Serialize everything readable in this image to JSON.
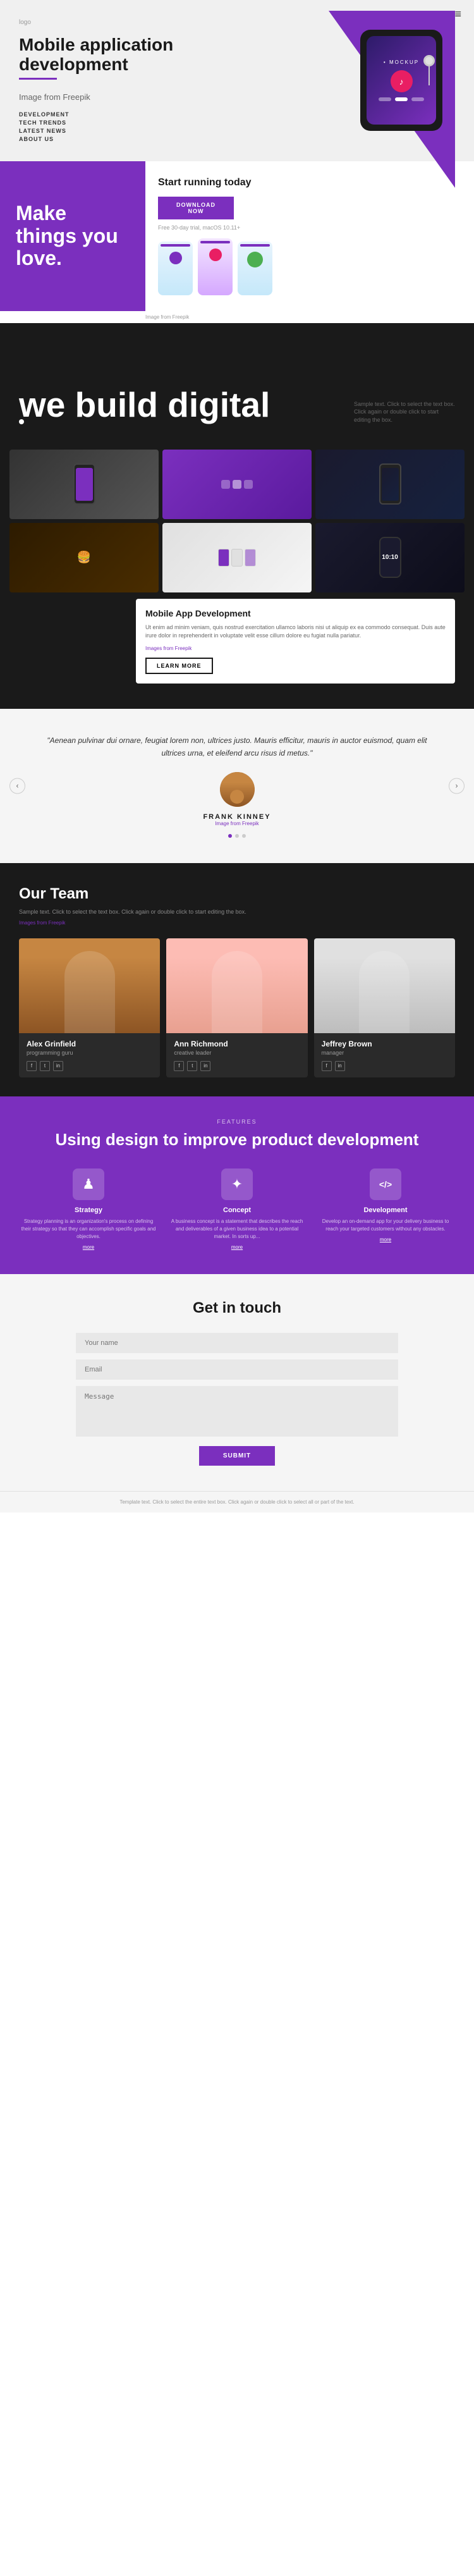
{
  "header": {
    "logo": "logo",
    "hamburger": "≡",
    "hero_title": "Mobile application development",
    "hero_subtitle": "Image from Freepik",
    "nav_items": [
      "DEVELOPMENT",
      "TECH TRENDS",
      "LATEST NEWS",
      "ABOUT US"
    ],
    "mockup_label": "• MOCKUP"
  },
  "section_make": {
    "title": "Make things you love.",
    "start_running_title": "Start running today",
    "download_btn": "DOWNLOAD NOW",
    "trial_text": "Free 30-day trial, macOS 10.11+",
    "image_from": "Image from Freepik"
  },
  "section_build": {
    "title": "we build digital",
    "sample_text": "Sample text. Click to select the text box. Click again or double click to start editing the box."
  },
  "section_portfolio": {
    "mobile_app_title": "Mobile App Development",
    "mobile_app_text": "Ut enim ad minim veniam, quis nostrud exercitation ullamco laboris nisi ut aliquip ex ea commodo consequat. Duis aute irure dolor in reprehenderit in voluptate velit esse cillum dolore eu fugiat nulla pariatur.",
    "images_from": "Images from Freepik",
    "learn_more": "LEARN MORE"
  },
  "section_testimonial": {
    "quote": "\"Aenean pulvinar dui ornare, feugiat lorem non, ultrices justo. Mauris efficitur, mauris in auctor euismod, quam elit ultrices urna, et eleifend arcu risus id metus.\"",
    "name": "FRANK KINNEY",
    "image_from": "Image from Freepik",
    "dots": [
      true,
      false,
      false
    ]
  },
  "section_team": {
    "title": "Our Team",
    "sample_text": "Sample text. Click to select the text box. Click again or double click to start editing the box.",
    "images_from": "Images from Freepik",
    "members": [
      {
        "name": "Alex Grinfield",
        "role": "programming guru"
      },
      {
        "name": "Ann Richmond",
        "role": "creative leader"
      },
      {
        "name": "Jeffrey Brown",
        "role": "manager"
      }
    ]
  },
  "section_features": {
    "label": "FEATURES",
    "title": "Using design to improve product development",
    "features": [
      {
        "name": "Strategy",
        "icon": "♟",
        "desc": "Strategy planning is an organization's process on defining their strategy so that they can accomplish specific goals and objectives.",
        "link": "more"
      },
      {
        "name": "Concept",
        "icon": "✦",
        "desc": "A business concept is a statement that describes the reach and deliverables of a given business idea to a potential market. In sorts up...",
        "link": "more"
      },
      {
        "name": "Development",
        "icon": "</>",
        "desc": "Develop an on-demand app for your delivery business to reach your targeted customers without any obstacles.",
        "link": "more"
      }
    ]
  },
  "section_contact": {
    "title": "Get in touch",
    "fields": {
      "name_placeholder": "Your name",
      "email_placeholder": "Email",
      "message_placeholder": "Message"
    },
    "submit_btn": "SUBMIT"
  },
  "footer": {
    "text": "Template text. Click to select the entire text box. Click again or double click to select all or part of the text."
  }
}
